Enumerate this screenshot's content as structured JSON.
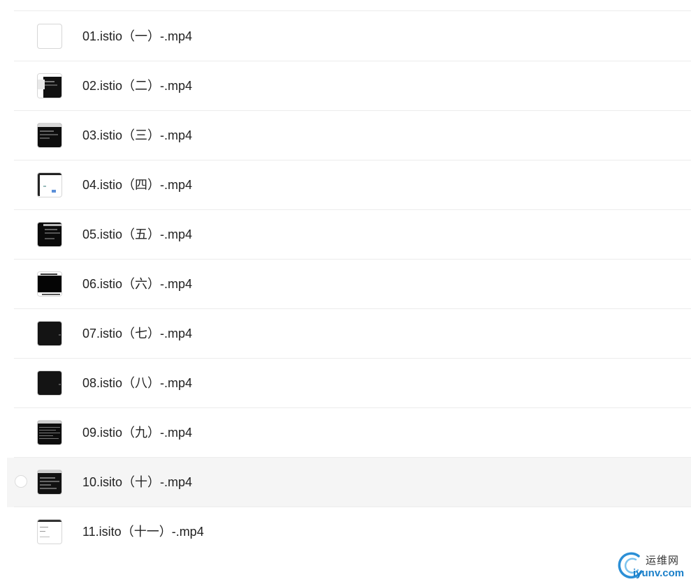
{
  "files": [
    {
      "name": "01.istio（一）-.mp4",
      "thumb": "white"
    },
    {
      "name": "02.istio（二）-.mp4",
      "thumb": "terminal-split"
    },
    {
      "name": "03.istio（三）-.mp4",
      "thumb": "terminal"
    },
    {
      "name": "04.istio（四）-.mp4",
      "thumb": "diagram"
    },
    {
      "name": "05.istio（五）-.mp4",
      "thumb": "terminal-dark"
    },
    {
      "name": "06.istio（六）-.mp4",
      "thumb": "black-screen"
    },
    {
      "name": "07.istio（七）-.mp4",
      "thumb": "dark"
    },
    {
      "name": "08.istio（八）-.mp4",
      "thumb": "dark"
    },
    {
      "name": "09.istio（九）-.mp4",
      "thumb": "terminal-lines"
    },
    {
      "name": "10.isito（十）-.mp4",
      "thumb": "terminal-box",
      "hovered": true
    },
    {
      "name": "11.isito（十一）-.mp4",
      "thumb": "document"
    }
  ],
  "watermark": {
    "cn": "运维网",
    "en": "iyunv.com"
  },
  "colors": {
    "row_hover": "#f5f5f5",
    "separator": "#ececec",
    "text": "#222222",
    "watermark_blue": "#1a7fc9"
  }
}
